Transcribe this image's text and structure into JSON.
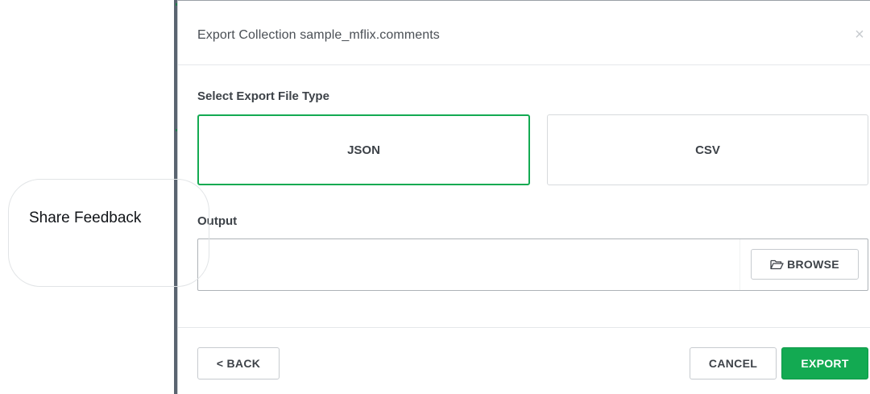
{
  "modal": {
    "title": "Export Collection sample_mflix.comments",
    "close_glyph": "×",
    "close_icon": "close-icon"
  },
  "file_type": {
    "label": "Select Export File Type",
    "options": [
      {
        "label": "JSON",
        "selected": true
      },
      {
        "label": "CSV",
        "selected": false
      }
    ]
  },
  "output": {
    "label": "Output",
    "value": "",
    "browse_label": "BROWSE",
    "browse_icon": "folder-open-icon"
  },
  "footer": {
    "back_label": "< BACK",
    "cancel_label": "CANCEL",
    "export_label": "EXPORT"
  },
  "feedback": {
    "label": "Share Feedback"
  },
  "colors": {
    "accent": "#13aa52",
    "text": "#3d4248",
    "border": "#d7dadd"
  }
}
